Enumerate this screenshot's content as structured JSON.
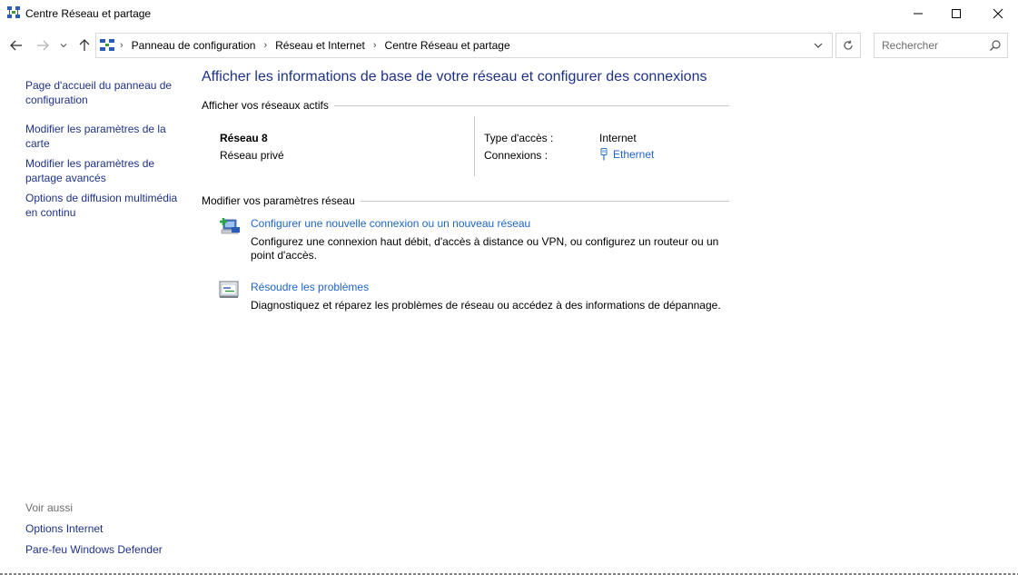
{
  "window": {
    "title": "Centre Réseau et partage"
  },
  "nav": {
    "breadcrumbs": [
      "Panneau de configuration",
      "Réseau et Internet",
      "Centre Réseau et partage"
    ],
    "search_placeholder": "Rechercher"
  },
  "left_pane": {
    "links": [
      "Page d'accueil du panneau de configuration",
      "Modifier les paramètres de la carte",
      "Modifier les paramètres de partage avancés",
      "Options de diffusion multimédia en continu"
    ],
    "see_also_label": "Voir aussi",
    "see_also_links": [
      "Options Internet",
      "Pare-feu Windows Defender"
    ]
  },
  "main": {
    "title": "Afficher les informations de base de votre réseau et configurer des connexions",
    "active_networks_heading": "Afficher vos réseaux actifs",
    "network": {
      "name": "Réseau 8",
      "category": "Réseau privé",
      "access_type_label": "Type d'accès :",
      "access_type_value": "Internet",
      "connections_label": "Connexions :",
      "connections_value": "Ethernet"
    },
    "change_settings_heading": "Modifier vos paramètres réseau",
    "tasks": [
      {
        "icon": "new-connection-icon",
        "title": "Configurer une nouvelle connexion ou un nouveau réseau",
        "description": "Configurez une connexion haut débit, d'accès à distance ou VPN, ou configurez un routeur ou un point d'accès."
      },
      {
        "icon": "troubleshoot-icon",
        "title": "Résoudre les problèmes",
        "description": "Diagnostiquez et réparez les problèmes de réseau ou accédez à des informations de dépannage."
      }
    ]
  },
  "colors": {
    "link_dark": "#1e3287",
    "link": "#1e64c8",
    "muted": "#6d6d6d",
    "border": "#d9d9d9"
  }
}
